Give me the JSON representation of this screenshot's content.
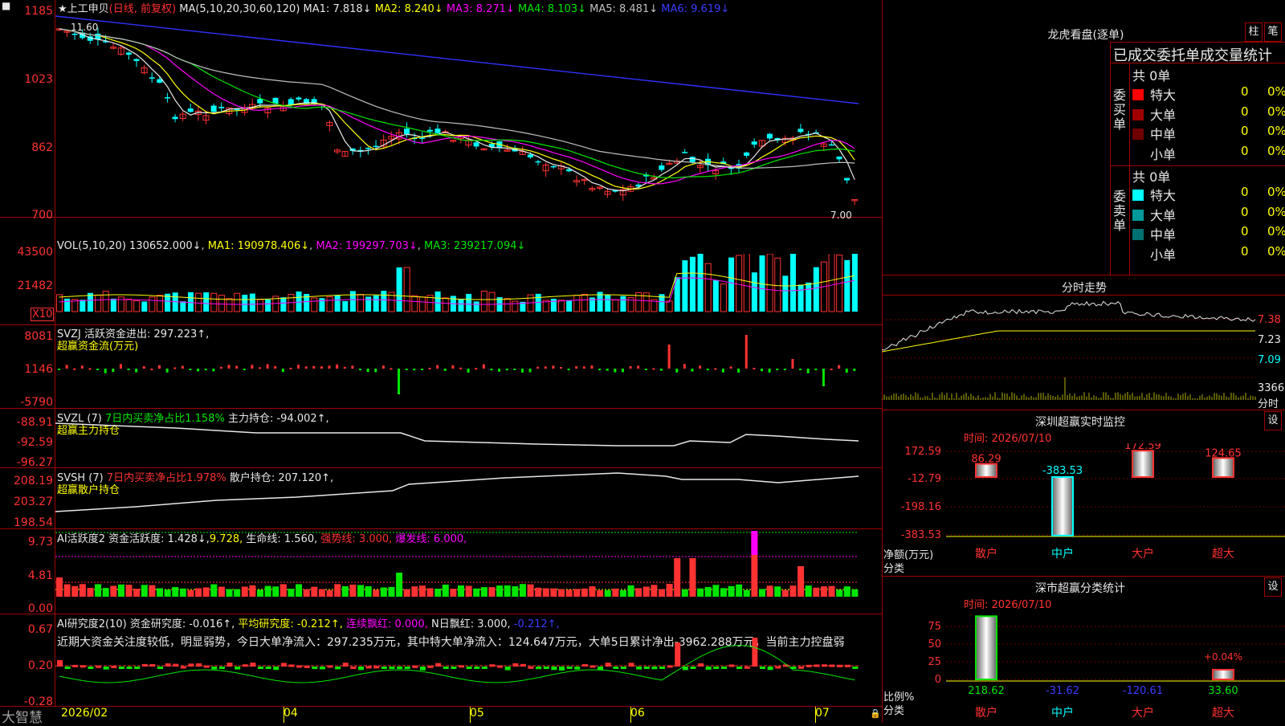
{
  "main_chart": {
    "stock_name": "上工申贝",
    "period": "(日线, 前复权)",
    "ma_params": "MA(5,10,20,30,60,120)",
    "ma_values": [
      {
        "label": "MA1: 7.818↓",
        "color": "#e8e8e8"
      },
      {
        "label": "MA2: 8.240↓",
        "color": "#ffff00"
      },
      {
        "label": "MA3: 8.271↓",
        "color": "#ff00ff"
      },
      {
        "label": "MA4: 8.103↓",
        "color": "#00e600"
      },
      {
        "label": "MA5: 8.481↓",
        "color": "#c0c0c0"
      },
      {
        "label": "MA6: 9.619↓",
        "color": "#3c3cff"
      }
    ],
    "y_ticks": [
      "1185",
      "1023",
      "862",
      "700"
    ],
    "high_label": "11.60",
    "low_label": "7.00"
  },
  "vol_panel": {
    "header": "VOL(5,10,20)",
    "current": "130652.000↓",
    "ma1": "MA1: 190978.406↓",
    "ma2": "MA2: 199297.703↓",
    "ma3": "MA3: 239217.094↓",
    "y_ticks": [
      "43500",
      "21482"
    ],
    "unit": "X10"
  },
  "svzj_panel": {
    "header": "SVZJ  活跃资金进出: 297.223↑,",
    "subtitle": "超赢资金流(万元)",
    "y_ticks": [
      "8081",
      "1146",
      "-5790"
    ]
  },
  "svzl_panel": {
    "header1": "SVZL (7)",
    "header2": "7日内买卖净占比1.158%",
    "header3": "主力持仓: -94.002↑,",
    "subtitle": "超赢主力持仓",
    "y_ticks": [
      "-88.91",
      "-92.59",
      "-96.27"
    ]
  },
  "svsh_panel": {
    "header1": "SVSH (7)",
    "header2": "7日内买卖净占比1.978%",
    "header3": "散户持仓: 207.120↑,",
    "subtitle": "超赢散户持仓",
    "y_ticks": [
      "208.19",
      "203.27",
      "198.54"
    ]
  },
  "ai_active": {
    "header1": "AI活跃度2 资金活跃度: 1.428↓,",
    "header2": "9.728,",
    "header3": "生命线: 1.560,",
    "header4": "强势线: 3.000,",
    "header5": "爆发线: 6.000,",
    "y_ticks": [
      "9.73",
      "4.81",
      "0.00"
    ]
  },
  "ai_research": {
    "header1": "AI研究度2(10) 资金研究度: -0.016↑,",
    "header2": "平均研究度: -0.212↑,",
    "header3": "连续飘红: 0.000,",
    "header4": "N日飘红: 3.000,",
    "header5": "-0.212↑,",
    "description": "近期大资金关注度较低，明显弱势，今日大单净流入：297.235万元，其中特大单净流入：124.647万元，大单5日累计净出-3962.288万元，当前主力控盘弱",
    "y_ticks": [
      "0.67",
      "0.20",
      "-0.28"
    ]
  },
  "x_axis": {
    "labels": [
      "2026/02",
      "04",
      "05",
      "06",
      "07"
    ]
  },
  "footer": {
    "brand": "大智慧"
  },
  "right_panel": {
    "title": "龙虎看盘(逐单)",
    "btn_column": "柱",
    "btn_stroke": "笔",
    "stats_title": "已成交委托单成交量统计",
    "buy_label": "委买单",
    "sell_label": "委卖单",
    "buy_total": "共 0单",
    "sell_total": "共 0单",
    "buy_rows": [
      {
        "name": "特大",
        "count": "0",
        "pct": "0%",
        "color": "#ff0000"
      },
      {
        "name": "大单",
        "count": "0",
        "pct": "0%",
        "color": "#a00000"
      },
      {
        "name": "中单",
        "count": "0",
        "pct": "0%",
        "color": "#700000"
      },
      {
        "name": "小单",
        "count": "0",
        "pct": "0%",
        "color": "#000000"
      }
    ],
    "sell_rows": [
      {
        "name": "特大",
        "count": "0",
        "pct": "0%",
        "color": "#00ffff"
      },
      {
        "name": "大单",
        "count": "0",
        "pct": "0%",
        "color": "#009a9a"
      },
      {
        "name": "中单",
        "count": "0",
        "pct": "0%",
        "color": "#007070"
      },
      {
        "name": "小单",
        "count": "0",
        "pct": "0%",
        "color": "#000000"
      }
    ],
    "minute": {
      "title": "分时走势",
      "prices": [
        "7.38",
        "7.23",
        "7.09"
      ],
      "vol": "3366",
      "vol_label": "分时"
    },
    "monitor": {
      "title": "深圳超赢实时监控",
      "btn": "设",
      "time": "时间: 2026/07/10",
      "y_ticks": [
        "172.59",
        "-12.79",
        "-198.16",
        "-383.53"
      ],
      "unit1": "净额(万元)",
      "unit2": "分类",
      "categories": [
        "散户",
        "中户",
        "大户",
        "超大"
      ],
      "values": [
        86.29,
        -383.53,
        172.59,
        124.65
      ],
      "value_labels": [
        "86.29",
        "-383.53",
        "172.59",
        "124.65"
      ]
    },
    "classify": {
      "title": "深市超赢分类统计",
      "btn": "设",
      "time": "时间: 2026/07/10",
      "y_ticks": [
        "75",
        "50",
        "25",
        "0"
      ],
      "unit1": "比例%",
      "unit2": "分类",
      "categories": [
        "散户",
        "中户",
        "大户",
        "超大"
      ],
      "values": [
        218.62,
        -31.62,
        -120.61,
        33.6
      ],
      "value_labels": [
        "218.62",
        "-31.62",
        "-120.61",
        "33.60"
      ],
      "extra_label": "+0.04%"
    }
  }
}
